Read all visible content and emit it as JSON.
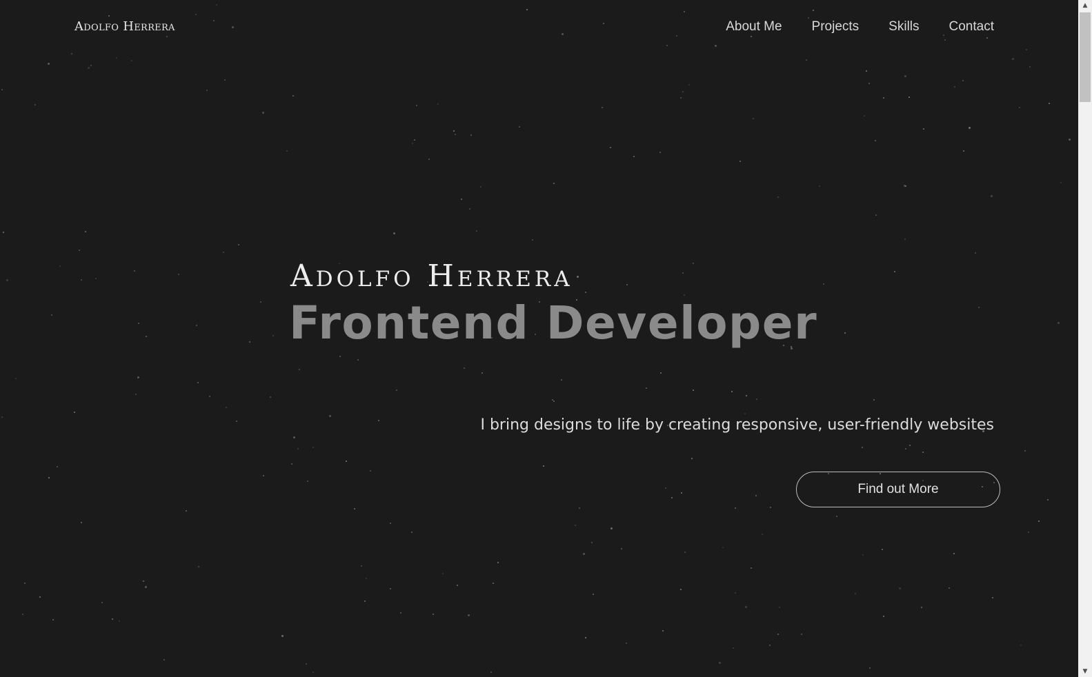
{
  "header": {
    "logo": "Adolfo Herrera",
    "nav": [
      {
        "label": "About Me"
      },
      {
        "label": "Projects"
      },
      {
        "label": "Skills"
      },
      {
        "label": "Contact"
      }
    ]
  },
  "hero": {
    "name": "Adolfo Herrera",
    "title": "Frontend Developer",
    "tagline": "I bring designs to life by creating responsive, user-friendly websites",
    "cta_label": "Find out More"
  },
  "colors": {
    "background": "#1c1b1c",
    "title": "#8a8a8a",
    "text": "#e6e6e6"
  },
  "scrollbar": {
    "up_icon": "caret-up-icon",
    "down_icon": "caret-down-icon"
  }
}
